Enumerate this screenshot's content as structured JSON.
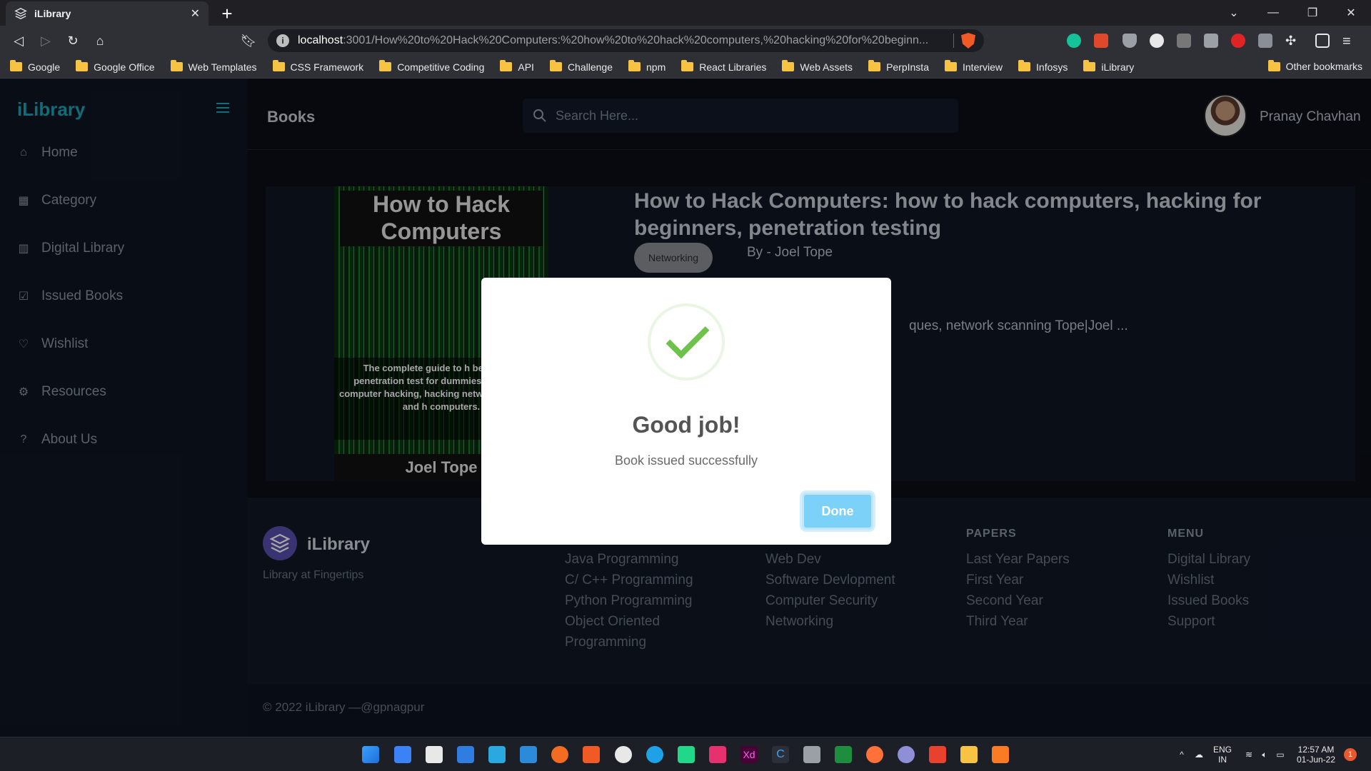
{
  "browser": {
    "tab_title": "iLibrary",
    "url_host": "localhost",
    "url_path": ":3001/How%20to%20Hack%20Computers:%20how%20to%20hack%20computers,%20hacking%20for%20beginn...",
    "bookmarks": [
      "Google",
      "Google Office",
      "Web Templates",
      "CSS Framework",
      "Competitive Coding",
      "API",
      "Challenge",
      "npm",
      "React Libraries",
      "Web Assets",
      "PerpInsta",
      "Interview",
      "Infosys",
      "iLibrary"
    ],
    "other_bookmarks": "Other bookmarks"
  },
  "sidebar": {
    "brand": "iLibrary",
    "items": [
      {
        "label": "Home",
        "icon": "home-icon"
      },
      {
        "label": "Category",
        "icon": "grid-icon"
      },
      {
        "label": "Digital Library",
        "icon": "library-icon"
      },
      {
        "label": "Issued Books",
        "icon": "check-square-icon"
      },
      {
        "label": "Wishlist",
        "icon": "heart-icon"
      },
      {
        "label": "Resources",
        "icon": "gear-icon"
      },
      {
        "label": "About Us",
        "icon": "help-icon"
      }
    ]
  },
  "header": {
    "title": "Books",
    "search_placeholder": "Search Here...",
    "user_name": "Pranay Chavhan"
  },
  "book": {
    "title": "How to Hack Computers: how to hack computers, hacking for beginners, penetration testing",
    "category": "Networking",
    "author": "By - Joel Tope",
    "description_visible": "ques, network scanning Tope|Joel ...",
    "cover": {
      "title": "How to Hack Computers",
      "subtitle": "The complete guide to h beginners, penetration test for dummies, computer computer hacking, hacking network scanning, and h computers.",
      "author": "Joel Tope"
    }
  },
  "footer": {
    "brand": "iLibrary",
    "tagline": "Library at Fingertips",
    "columns": [
      {
        "heading": "",
        "links": [
          "Java Programming",
          "C/ C++ Programming",
          "Python Programming",
          "Object Oriented Programming"
        ]
      },
      {
        "heading": "",
        "links": [
          "Web Dev",
          "Software Devlopment",
          "Computer Security",
          "Networking"
        ]
      },
      {
        "heading": "PAPERS",
        "links": [
          "Last Year Papers",
          "First Year",
          "Second Year",
          "Third Year"
        ]
      },
      {
        "heading": "MENU",
        "links": [
          "Digital Library",
          "Wishlist",
          "Issued Books",
          "Support"
        ]
      }
    ],
    "copyright": "© 2022 iLibrary —@gpnagpur"
  },
  "modal": {
    "title": "Good job!",
    "text": "Book issued successfully",
    "button": "Done"
  },
  "taskbar": {
    "lang1": "ENG",
    "lang2": "IN",
    "time": "12:57 AM",
    "date": "01-Jun-22",
    "notifications": "1"
  },
  "colors": {
    "accent": "#1aa6b7",
    "success": "#6cc24a",
    "done_button": "#7cd1f9"
  }
}
